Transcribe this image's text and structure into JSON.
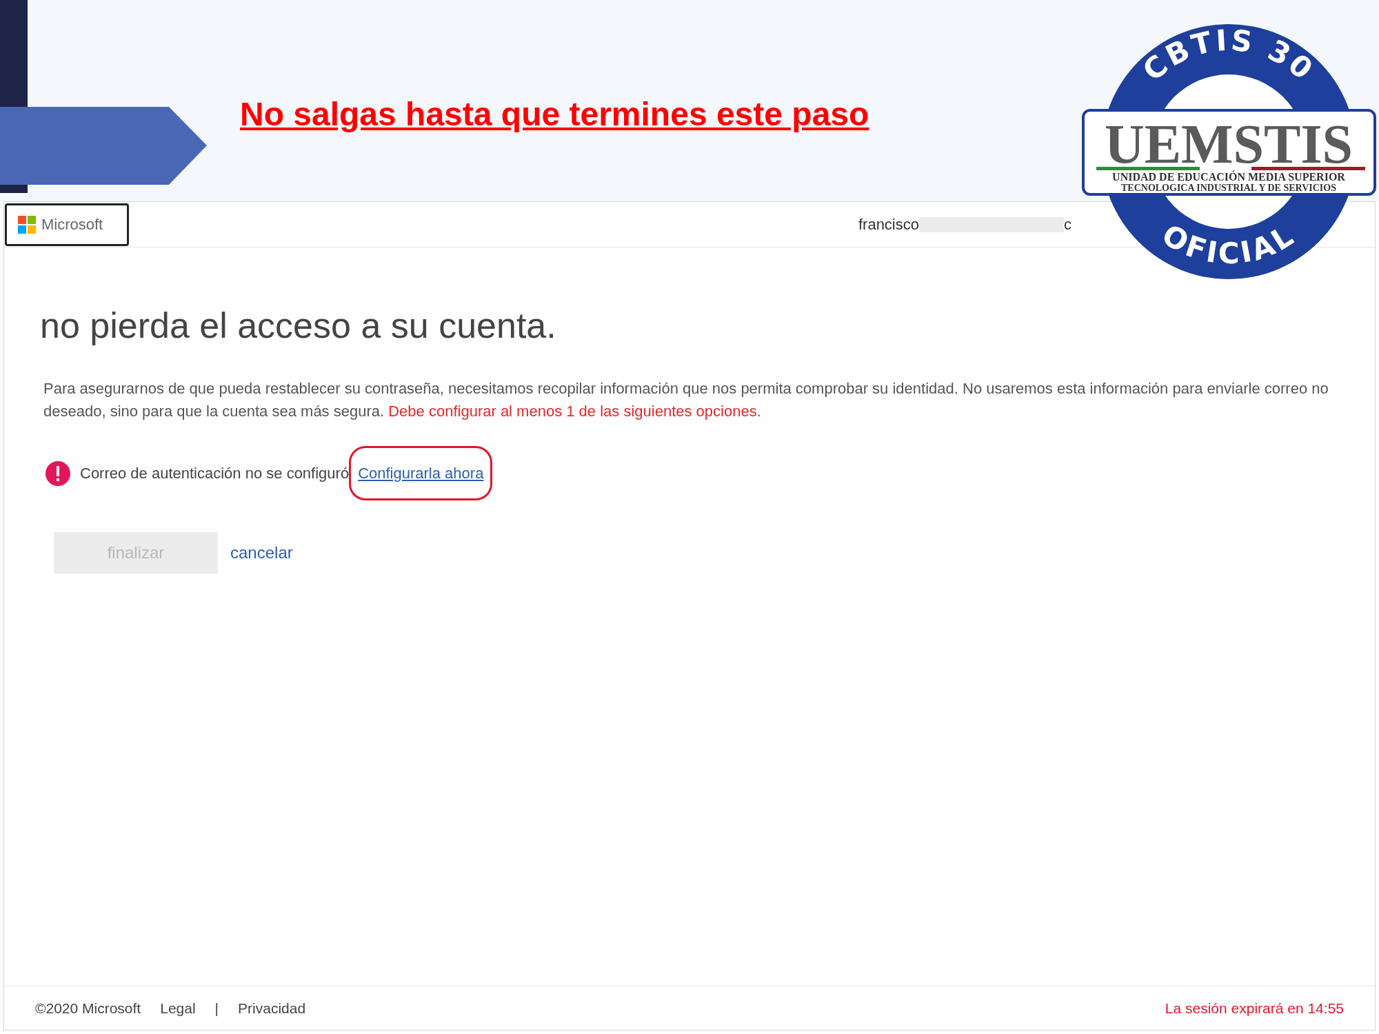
{
  "slide": {
    "heading": "No salgas hasta que termines este paso"
  },
  "logo": {
    "top": "CBTIS 30",
    "name": "UEMSTIS",
    "subtitle_1": "UNIDAD DE EDUCACIÓN MEDIA SUPERIOR",
    "subtitle_2": "TECNOLOGICA INDUSTRIAL Y DE SERVICIOS",
    "bottom": "OFICIAL"
  },
  "header": {
    "brand": "Microsoft",
    "user": "francisco",
    "user_tail": "c"
  },
  "page": {
    "title": "no pierda el acceso a su cuenta.",
    "paragraph": "Para asegurarnos de que pueda restablecer su contraseña, necesitamos recopilar información que nos permita comprobar su identidad. No usaremos esta información para enviarle correo no deseado, sino para que la cuenta sea más segura.",
    "warning": "Debe configurar al menos 1 de las siguientes opciones.",
    "methods": [
      {
        "label": "Correo de autenticación no se configuró",
        "link": "Configurarla ahora",
        "highlighted": true
      }
    ],
    "buttons": [
      {
        "label": "finalizar",
        "disabled": true,
        "kind": "button"
      },
      {
        "label": "cancelar",
        "disabled": false,
        "kind": "link"
      }
    ]
  },
  "footer": {
    "links": [
      "©2020 Microsoft",
      "Legal",
      "|",
      "Privacidad"
    ],
    "session": "La sesión expirará en 14:55"
  }
}
